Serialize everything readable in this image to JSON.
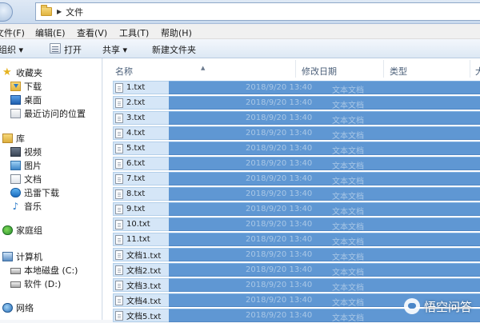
{
  "address_bar": {
    "path": "文件"
  },
  "menu": [
    "文件(F)",
    "编辑(E)",
    "查看(V)",
    "工具(T)",
    "帮助(H)"
  ],
  "commands": {
    "organize": "组织 ▾",
    "open": "打开",
    "share": "共享 ▾",
    "new_folder": "新建文件夹"
  },
  "nav": {
    "favorites": {
      "label": "收藏夹",
      "items": [
        "下载",
        "桌面",
        "最近访问的位置"
      ]
    },
    "libraries": {
      "label": "库",
      "items": [
        "视频",
        "图片",
        "文档",
        "迅雷下载",
        "音乐"
      ]
    },
    "homegroup": "家庭组",
    "computer": {
      "label": "计算机",
      "items": [
        "本地磁盘 (C:)",
        "软件 (D:)"
      ]
    },
    "network": "网络"
  },
  "columns": {
    "name": "名称",
    "date": "修改日期",
    "type": "类型",
    "extra": "大"
  },
  "files": [
    {
      "name": "1.txt",
      "date": "2018/9/20 13:40",
      "type": "文本文档"
    },
    {
      "name": "2.txt",
      "date": "2018/9/20 13:40",
      "type": "文本文档"
    },
    {
      "name": "3.txt",
      "date": "2018/9/20 13:40",
      "type": "文本文档"
    },
    {
      "name": "4.txt",
      "date": "2018/9/20 13:40",
      "type": "文本文档"
    },
    {
      "name": "5.txt",
      "date": "2018/9/20 13:40",
      "type": "文本文档"
    },
    {
      "name": "6.txt",
      "date": "2018/9/20 13:40",
      "type": "文本文档"
    },
    {
      "name": "7.txt",
      "date": "2018/9/20 13:40",
      "type": "文本文档"
    },
    {
      "name": "8.txt",
      "date": "2018/9/20 13:40",
      "type": "文本文档"
    },
    {
      "name": "9.txt",
      "date": "2018/9/20 13:40",
      "type": "文本文档"
    },
    {
      "name": "10.txt",
      "date": "2018/9/20 13:40",
      "type": "文本文档"
    },
    {
      "name": "11.txt",
      "date": "2018/9/20 13:40",
      "type": "文本文档"
    },
    {
      "name": "文档1.txt",
      "date": "2018/9/20 13:40",
      "type": "文本文档"
    },
    {
      "name": "文档2.txt",
      "date": "2018/9/20 13:40",
      "type": "文本文档"
    },
    {
      "name": "文档3.txt",
      "date": "2018/9/20 13:40",
      "type": "文本文档"
    },
    {
      "name": "文档4.txt",
      "date": "2018/9/20 13:40",
      "type": "文本文档"
    },
    {
      "name": "文档5.txt",
      "date": "2018/9/20 13:40",
      "type": "文本文档"
    }
  ],
  "watermark": "悟空问答",
  "colors": {
    "selection": "#5f97d3",
    "name_cell": "#d5e6f7",
    "header_text": "#4c607a"
  }
}
